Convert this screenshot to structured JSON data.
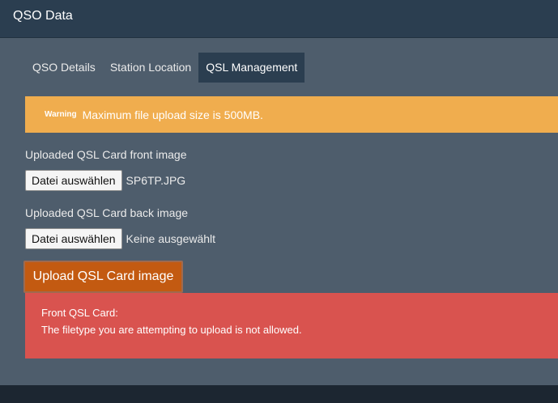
{
  "header": {
    "title": "QSO Data"
  },
  "tabs": [
    {
      "label": "QSO Details",
      "active": false
    },
    {
      "label": "Station Location",
      "active": false
    },
    {
      "label": "QSL Management",
      "active": true
    }
  ],
  "warning": {
    "badge": "Warning",
    "text": "Maximum file upload size is 500MB."
  },
  "front_image": {
    "label": "Uploaded QSL Card front image",
    "button_label": "Datei auswählen",
    "file_name": "SP6TP.JPG"
  },
  "back_image": {
    "label": "Uploaded QSL Card back image",
    "button_label": "Datei auswählen",
    "file_name": "Keine ausgewählt"
  },
  "upload_button": {
    "label": "Upload QSL Card image"
  },
  "error": {
    "title": "Front QSL Card:",
    "message": "The filetype you are attempting to upload is not allowed."
  },
  "colors": {
    "panel": "#4e5d6c",
    "header": "#2b3e50",
    "warning": "#f0ad4e",
    "upload_button": "#c35a11",
    "error": "#d9534f"
  }
}
